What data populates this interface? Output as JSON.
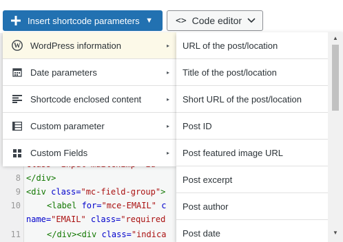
{
  "toolbar": {
    "insert_label": "Insert shortcode parameters",
    "insert_caret": "▼",
    "code_editor_icon": "<>",
    "code_editor_label": "Code editor",
    "code_editor_chevron": "⌄"
  },
  "editor": {
    "lines": [
      {
        "num": "",
        "html_id": "l0"
      },
      {
        "num": "8",
        "html_id": "l8"
      },
      {
        "num": "9",
        "html_id": "l9"
      },
      {
        "num": "10",
        "html_id": "l10"
      },
      {
        "num": "",
        "html_id": "l10b"
      },
      {
        "num": "11",
        "html_id": "l11"
      }
    ],
    "snippets": {
      "l0": "class=\"input mailchimp\" id",
      "l8": "</div>",
      "l9a": "<div ",
      "l9b": "class=",
      "l9c": "\"mc-field-group\"",
      "l9d": ">",
      "l10a": "<label ",
      "l10b": "for=",
      "l10c": "\"mce-EMAIL\"",
      "l10d": " c",
      "l10e": "name=",
      "l10f": "\"EMAIL\"",
      "l10g": " class=",
      "l10h": "\"required",
      "l11a": "</div><div ",
      "l11b": "class=",
      "l11c": "\"indica"
    }
  },
  "menu": {
    "items": [
      {
        "label": "WordPress information",
        "icon": "wordpress-icon"
      },
      {
        "label": "Date parameters",
        "icon": "calendar-icon"
      },
      {
        "label": "Shortcode enclosed content",
        "icon": "text-align-icon"
      },
      {
        "label": "Custom parameter",
        "icon": "table-icon"
      },
      {
        "label": "Custom Fields",
        "icon": "grid-icon"
      }
    ],
    "arrow": "▸"
  },
  "submenu": {
    "items": [
      {
        "label": "URL of the post/location"
      },
      {
        "label": "Title of the post/location"
      },
      {
        "label": "Short URL of the post/location"
      },
      {
        "label": "Post ID"
      },
      {
        "label": "Post featured image URL"
      },
      {
        "label": "Post excerpt"
      },
      {
        "label": "Post author"
      },
      {
        "label": "Post date"
      }
    ],
    "scroll_up": "▲",
    "scroll_down": "▼"
  },
  "colors": {
    "primary": "#2271b1",
    "active_item_bg": "#fcf9e8"
  }
}
